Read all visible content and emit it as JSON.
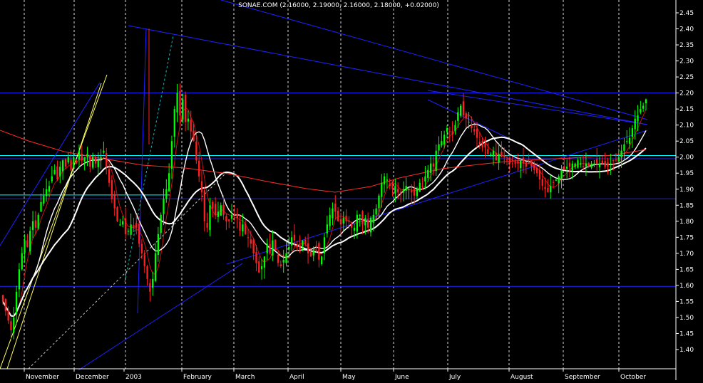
{
  "chart_data": {
    "type": "candlestick",
    "title": "SONAE.COM (2.16000, 2.19000, 2.16000, 2.18000, +0.02000)",
    "ylim": [
      1.34,
      2.49
    ],
    "y_ticks": [
      "2.45",
      "2.40",
      "2.35",
      "2.30",
      "2.25",
      "2.20",
      "2.15",
      "2.10",
      "2.05",
      "2.00",
      "1.95",
      "1.90",
      "1.85",
      "1.80",
      "1.75",
      "1.70",
      "1.65",
      "1.60",
      "1.55",
      "1.50",
      "1.45",
      "1.40"
    ],
    "x_labels": [
      "November",
      "December",
      "2003",
      "February",
      "March",
      "April",
      "May",
      "June",
      "July",
      "August",
      "September",
      "October"
    ],
    "grid": "vertical dashed, one per month",
    "colors": {
      "up": "#00ff00",
      "down": "#ff2020",
      "ma_short": "#ffffff",
      "ma_mid": "#d01010",
      "ma_long": "#ff2a2a",
      "trend": "#2020ff",
      "support": "#00ffff",
      "fan": "#ffff80"
    },
    "horizontal_levels": [
      {
        "y": 2.2,
        "color": "#2020ff"
      },
      {
        "y": 2.005,
        "color": "#00ffff"
      },
      {
        "y": 1.995,
        "color": "#2020ff"
      },
      {
        "y": 1.87,
        "color": "#2020ff"
      },
      {
        "y": 1.597,
        "color": "#2020ff"
      }
    ],
    "closes": [
      1.55,
      1.52,
      1.49,
      1.46,
      1.5,
      1.58,
      1.65,
      1.7,
      1.74,
      1.72,
      1.77,
      1.8,
      1.78,
      1.82,
      1.86,
      1.88,
      1.9,
      1.91,
      1.94,
      1.96,
      1.93,
      1.97,
      1.99,
      1.97,
      2.0,
      1.96,
      2.0,
      1.98,
      2.02,
      1.99,
      2.0,
      2.01,
      1.97,
      2.0,
      1.98,
      1.99,
      2.0,
      2.02,
      1.97,
      1.92,
      1.87,
      1.84,
      1.8,
      1.79,
      1.8,
      1.76,
      1.77,
      1.79,
      1.78,
      1.78,
      1.73,
      1.7,
      1.66,
      1.62,
      1.58,
      1.62,
      1.7,
      1.76,
      1.82,
      1.87,
      1.9,
      1.95,
      2.05,
      2.15,
      2.2,
      2.13,
      2.18,
      2.11,
      2.12,
      2.08,
      2.05,
      1.99,
      1.94,
      1.89,
      1.8,
      1.78,
      1.85,
      1.84,
      1.82,
      1.83,
      1.85,
      1.82,
      1.8,
      1.8,
      1.82,
      1.82,
      1.81,
      1.77,
      1.79,
      1.76,
      1.75,
      1.73,
      1.7,
      1.67,
      1.64,
      1.66,
      1.69,
      1.73,
      1.7,
      1.74,
      1.71,
      1.67,
      1.66,
      1.68,
      1.7,
      1.72,
      1.75,
      1.74,
      1.72,
      1.71,
      1.74,
      1.73,
      1.7,
      1.69,
      1.71,
      1.72,
      1.68,
      1.69,
      1.75,
      1.79,
      1.82,
      1.84,
      1.83,
      1.8,
      1.79,
      1.81,
      1.8,
      1.8,
      1.78,
      1.78,
      1.82,
      1.82,
      1.79,
      1.81,
      1.78,
      1.81,
      1.82,
      1.84,
      1.88,
      1.92,
      1.94,
      1.93,
      1.91,
      1.9,
      1.91,
      1.89,
      1.89,
      1.9,
      1.91,
      1.9,
      1.89,
      1.88,
      1.9,
      1.92,
      1.91,
      1.94,
      1.96,
      1.98,
      1.97,
      2.02,
      2.04,
      2.05,
      2.07,
      2.09,
      2.08,
      2.07,
      2.1,
      2.14,
      2.16,
      2.13,
      2.12,
      2.11,
      2.09,
      2.08,
      2.06,
      2.04,
      2.03,
      2.03,
      2.01,
      2.01,
      2.02,
      1.99,
      2.01,
      2.0,
      2.0,
      1.99,
      1.98,
      1.98,
      1.98,
      1.98,
      1.99,
      1.98,
      1.97,
      1.98,
      1.97,
      1.96,
      1.95,
      1.93,
      1.91,
      1.9,
      1.89,
      1.91,
      1.92,
      1.93,
      1.94,
      1.96,
      1.96,
      1.97,
      1.97,
      1.98,
      1.98,
      1.99,
      1.98,
      1.97,
      1.98,
      1.97,
      1.98,
      1.98,
      1.98,
      1.98,
      1.98,
      1.97,
      1.97,
      1.98,
      1.99,
      1.99,
      2.0,
      2.02,
      2.04,
      2.05,
      2.06,
      2.09,
      2.12,
      2.13,
      2.15,
      2.16,
      2.18
    ]
  }
}
